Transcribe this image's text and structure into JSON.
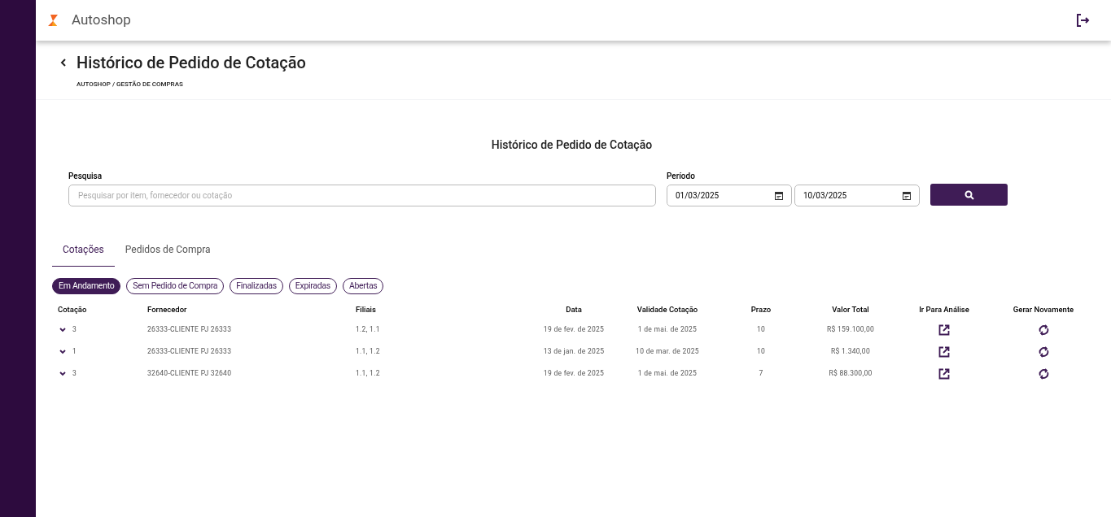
{
  "app": {
    "name": "Autoshop"
  },
  "page": {
    "title": "Histórico de Pedido de Cotação",
    "breadcrumb": "AUTOSHOP / GESTÃO DE COMPRAS"
  },
  "section_title": "Histórico de Pedido de Cotação",
  "search": {
    "label": "Pesquisa",
    "placeholder": "Pesquisar por item, fornecedor ou cotação"
  },
  "period": {
    "label": "Período",
    "start": "01/03/2025",
    "end": "10/03/2025"
  },
  "tabs": [
    {
      "label": "Cotações",
      "selected": true
    },
    {
      "label": "Pedidos de Compra",
      "selected": false
    }
  ],
  "filters": [
    {
      "label": "Em Andamento",
      "selected": true
    },
    {
      "label": "Sem Pedido de Compra",
      "selected": false
    },
    {
      "label": "Finalizadas",
      "selected": false
    },
    {
      "label": "Expiradas",
      "selected": false
    },
    {
      "label": "Abertas",
      "selected": false
    }
  ],
  "table": {
    "columns": [
      "Cotação",
      "Fornecedor",
      "Filiais",
      "Data",
      "Validade Cotação",
      "Prazo",
      "Valor Total",
      "Ir Para Análise",
      "Gerar Novamente"
    ],
    "rows": [
      {
        "cotacao": "3",
        "fornecedor": "26333-CLIENTE PJ 26333",
        "filiais": "1.2, 1.1",
        "data": "19 de fev. de 2025",
        "validade": "1 de mai. de 2025",
        "prazo": "10",
        "valor": "R$ 159.100,00"
      },
      {
        "cotacao": "1",
        "fornecedor": "26333-CLIENTE PJ 26333",
        "filiais": "1.1, 1.2",
        "data": "13 de jan. de 2025",
        "validade": "10 de mar. de 2025",
        "prazo": "10",
        "valor": "R$ 1.340,00"
      },
      {
        "cotacao": "3",
        "fornecedor": "32640-CLIENTE PJ 32640",
        "filiais": "1.1, 1.2",
        "data": "19 de fev. de 2025",
        "validade": "1 de mai. de 2025",
        "prazo": "7",
        "valor": "R$ 88.300,00"
      }
    ]
  }
}
